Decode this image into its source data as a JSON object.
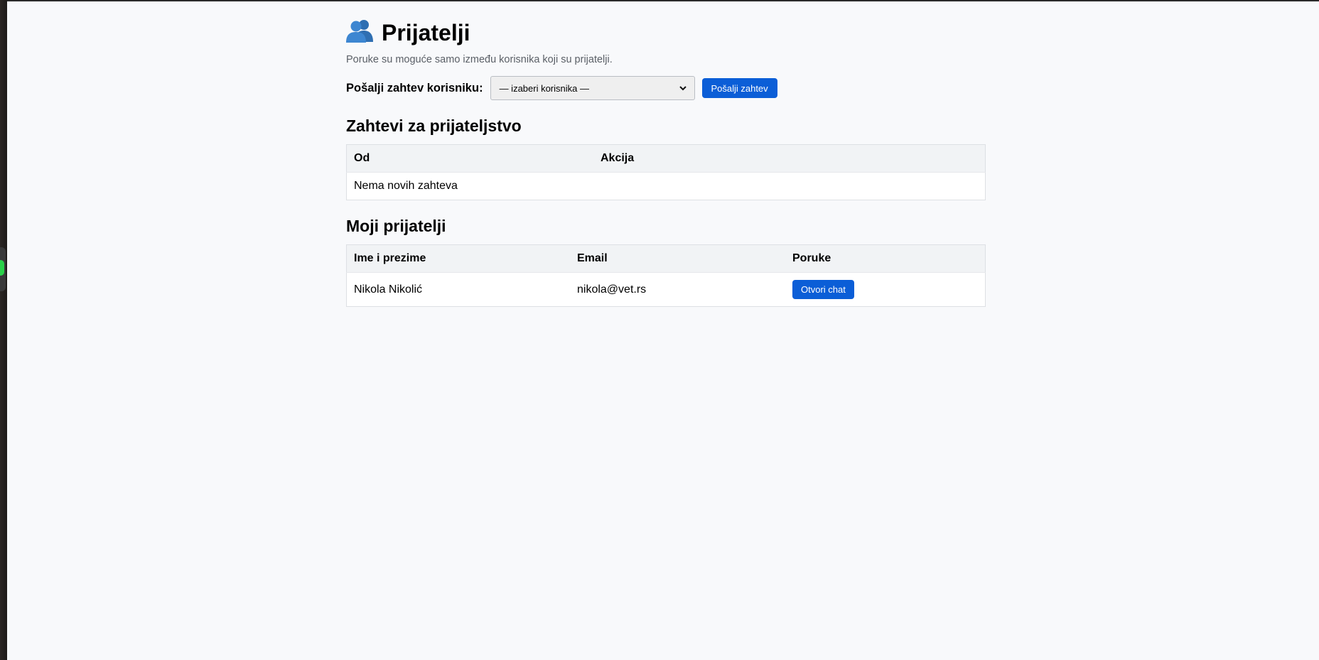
{
  "header": {
    "title": "Prijatelji",
    "subtitle": "Poruke su moguće samo između korisnika koji su prijatelji."
  },
  "send_request": {
    "label": "Pošalji zahtev korisniku:",
    "select_value": "— izaberi korisnika —",
    "button_label": "Pošalji zahtev"
  },
  "requests": {
    "heading": "Zahtevi za prijateljstvo",
    "columns": [
      "Od",
      "Akcija"
    ],
    "empty_text": "Nema novih zahteva"
  },
  "friends": {
    "heading": "Moji prijatelji",
    "columns": [
      "Ime i prezime",
      "Email",
      "Poruke"
    ],
    "rows": [
      {
        "name": "Nikola Nikolić",
        "email": "nikola@vet.rs",
        "action_label": "Otvori chat"
      }
    ]
  },
  "colors": {
    "accent": "#0b5ed7",
    "background": "#f8f9fb"
  }
}
